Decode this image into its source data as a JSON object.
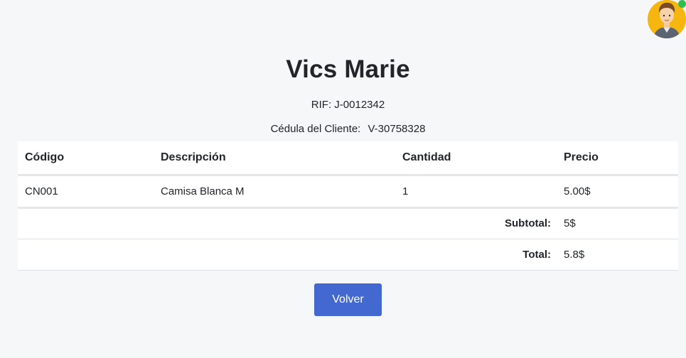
{
  "header": {
    "store_name": "Vics Marie",
    "rif": "RIF: J-0012342",
    "cedula_label": "Cédula del Cliente:",
    "cedula_value": "V-30758328"
  },
  "user": {
    "avatar_icon": "user-avatar-icon",
    "status_color": "#2dbe4e"
  },
  "table": {
    "columns": [
      "Código",
      "Descripción",
      "Cantidad",
      "Precio"
    ],
    "rows": [
      {
        "codigo": "CN001",
        "descripcion": "Camisa Blanca M",
        "cantidad": "1",
        "precio": "5.00$"
      }
    ],
    "subtotal_label": "Subtotal:",
    "subtotal_value": "5$",
    "total_label": "Total:",
    "total_value": "5.8$"
  },
  "actions": {
    "back_label": "Volver"
  },
  "colors": {
    "background": "#f6f7f9",
    "primary_button": "#4369d1",
    "avatar_bg": "#f5b70f"
  }
}
